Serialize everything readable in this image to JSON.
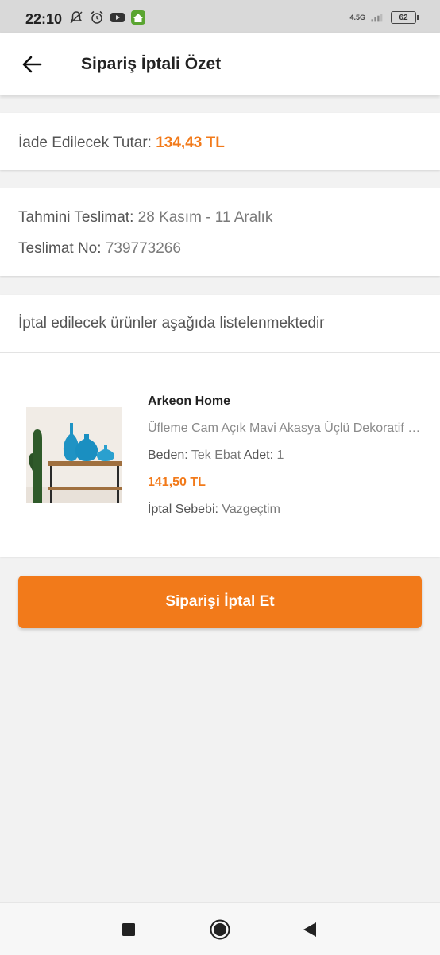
{
  "status_bar": {
    "time": "22:10",
    "network_label": "4.5G",
    "battery": "62",
    "left_icons": [
      "notification-off-icon",
      "alarm-icon",
      "youtube-icon",
      "home-app-icon"
    ],
    "right_icons": [
      "signal-icon",
      "battery-icon"
    ]
  },
  "header": {
    "title": "Sipariş İptali Özet",
    "back_icon": "arrow-left-icon"
  },
  "refund": {
    "label": "İade Edilecek Tutar:",
    "amount": "134,43 TL"
  },
  "delivery": {
    "estimated_label": "Tahmini Teslimat:",
    "estimated_value": "28 Kasım - 11 Aralık",
    "number_label": "Teslimat No:",
    "number_value": "739773266"
  },
  "items_section": {
    "heading": "İptal edilecek ürünler aşağıda listelenmektedir"
  },
  "product": {
    "brand": "Arkeon Home",
    "name": "Üfleme Cam Açık Mavi Akasya Üçlü Dekoratif Vazo",
    "size_label": "Beden:",
    "size_value": "Tek Ebat",
    "qty_label": "Adet:",
    "qty_value": "1",
    "price": "141,50 TL",
    "reason_label": "İptal Sebebi:",
    "reason_value": "Vazgeçtim"
  },
  "cta": {
    "label": "Siparişi İptal Et"
  },
  "nav_bar": {
    "icons": [
      "recent-apps-icon",
      "home-icon",
      "back-icon"
    ]
  },
  "colors": {
    "accent": "#f27a1a",
    "background": "#f2f2f2"
  }
}
